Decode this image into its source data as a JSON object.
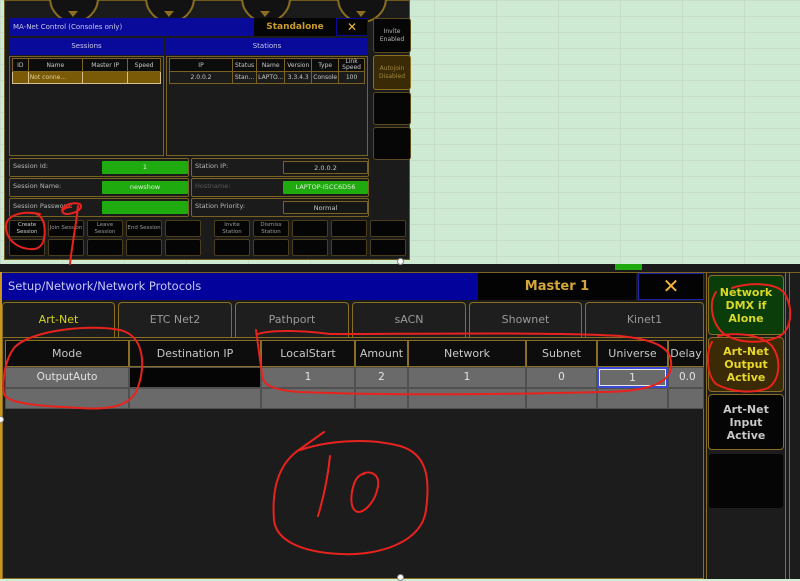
{
  "ma_net": {
    "title": "MA-Net Control (Consoles only)",
    "mode": "Standalone",
    "close_icon": "x-icon",
    "sessions_header": "Sessions",
    "stations_header": "Stations",
    "sessions_table": {
      "columns": [
        "ID",
        "Name",
        "Master IP",
        "Speed"
      ],
      "rows": [
        [
          "",
          "Not conne...",
          "",
          ""
        ]
      ]
    },
    "stations_table": {
      "columns": [
        "IP",
        "Status",
        "Name",
        "Version",
        "Type",
        "Link Speed"
      ],
      "rows": [
        [
          "2.0.0.2",
          "Stan...",
          "LAPTO...",
          "3.3.4.3",
          "Console",
          "100"
        ]
      ]
    },
    "side_buttons": [
      "Invite Enabled",
      "Autojoin Disabled",
      "",
      ""
    ],
    "fields": {
      "session_id_label": "Session Id:",
      "session_id": "1",
      "session_name_label": "Session Name:",
      "session_name": "newshow",
      "session_password_label": "Session Password:",
      "session_password": "",
      "station_ip_label": "Station IP:",
      "station_ip": "2.0.0.2",
      "hostname_label": "Hostname:",
      "hostname": "LAPTOP-I5CC6D56",
      "station_priority_label": "Station Priority:",
      "station_priority": "Normal"
    },
    "bottom_buttons": [
      "Create Session",
      "Join Session",
      "Leave Session",
      "End Session",
      "",
      "Invite Station",
      "Dismiss Station",
      "",
      "",
      ""
    ]
  },
  "protocols": {
    "title": "Setup/Network/Network Protocols",
    "master": "Master 1",
    "close_icon": "x-icon",
    "tabs": [
      {
        "label": "Art-Net",
        "active": true
      },
      {
        "label": "ETC Net2",
        "active": false
      },
      {
        "label": "Pathport",
        "active": false
      },
      {
        "label": "sACN",
        "active": false
      },
      {
        "label": "Shownet",
        "active": false
      },
      {
        "label": "Kinet1",
        "active": false
      }
    ],
    "columns": [
      "Mode",
      "Destination IP",
      "LocalStart",
      "Amount",
      "Network",
      "Subnet",
      "Universe",
      "Delay"
    ],
    "rows": [
      [
        "OutputAuto",
        "",
        "1",
        "2",
        "1",
        "0",
        "1",
        "0.0"
      ]
    ],
    "side_buttons": [
      {
        "label": "Network DMX if Alone",
        "state": "green"
      },
      {
        "label": "Art-Net Output Active",
        "state": "brown"
      },
      {
        "label": "Art-Net Input Active",
        "state": "black"
      },
      {
        "label": "",
        "state": "black"
      }
    ]
  },
  "annotations": {
    "handwritten_number": "10",
    "color": "#e8231e"
  }
}
